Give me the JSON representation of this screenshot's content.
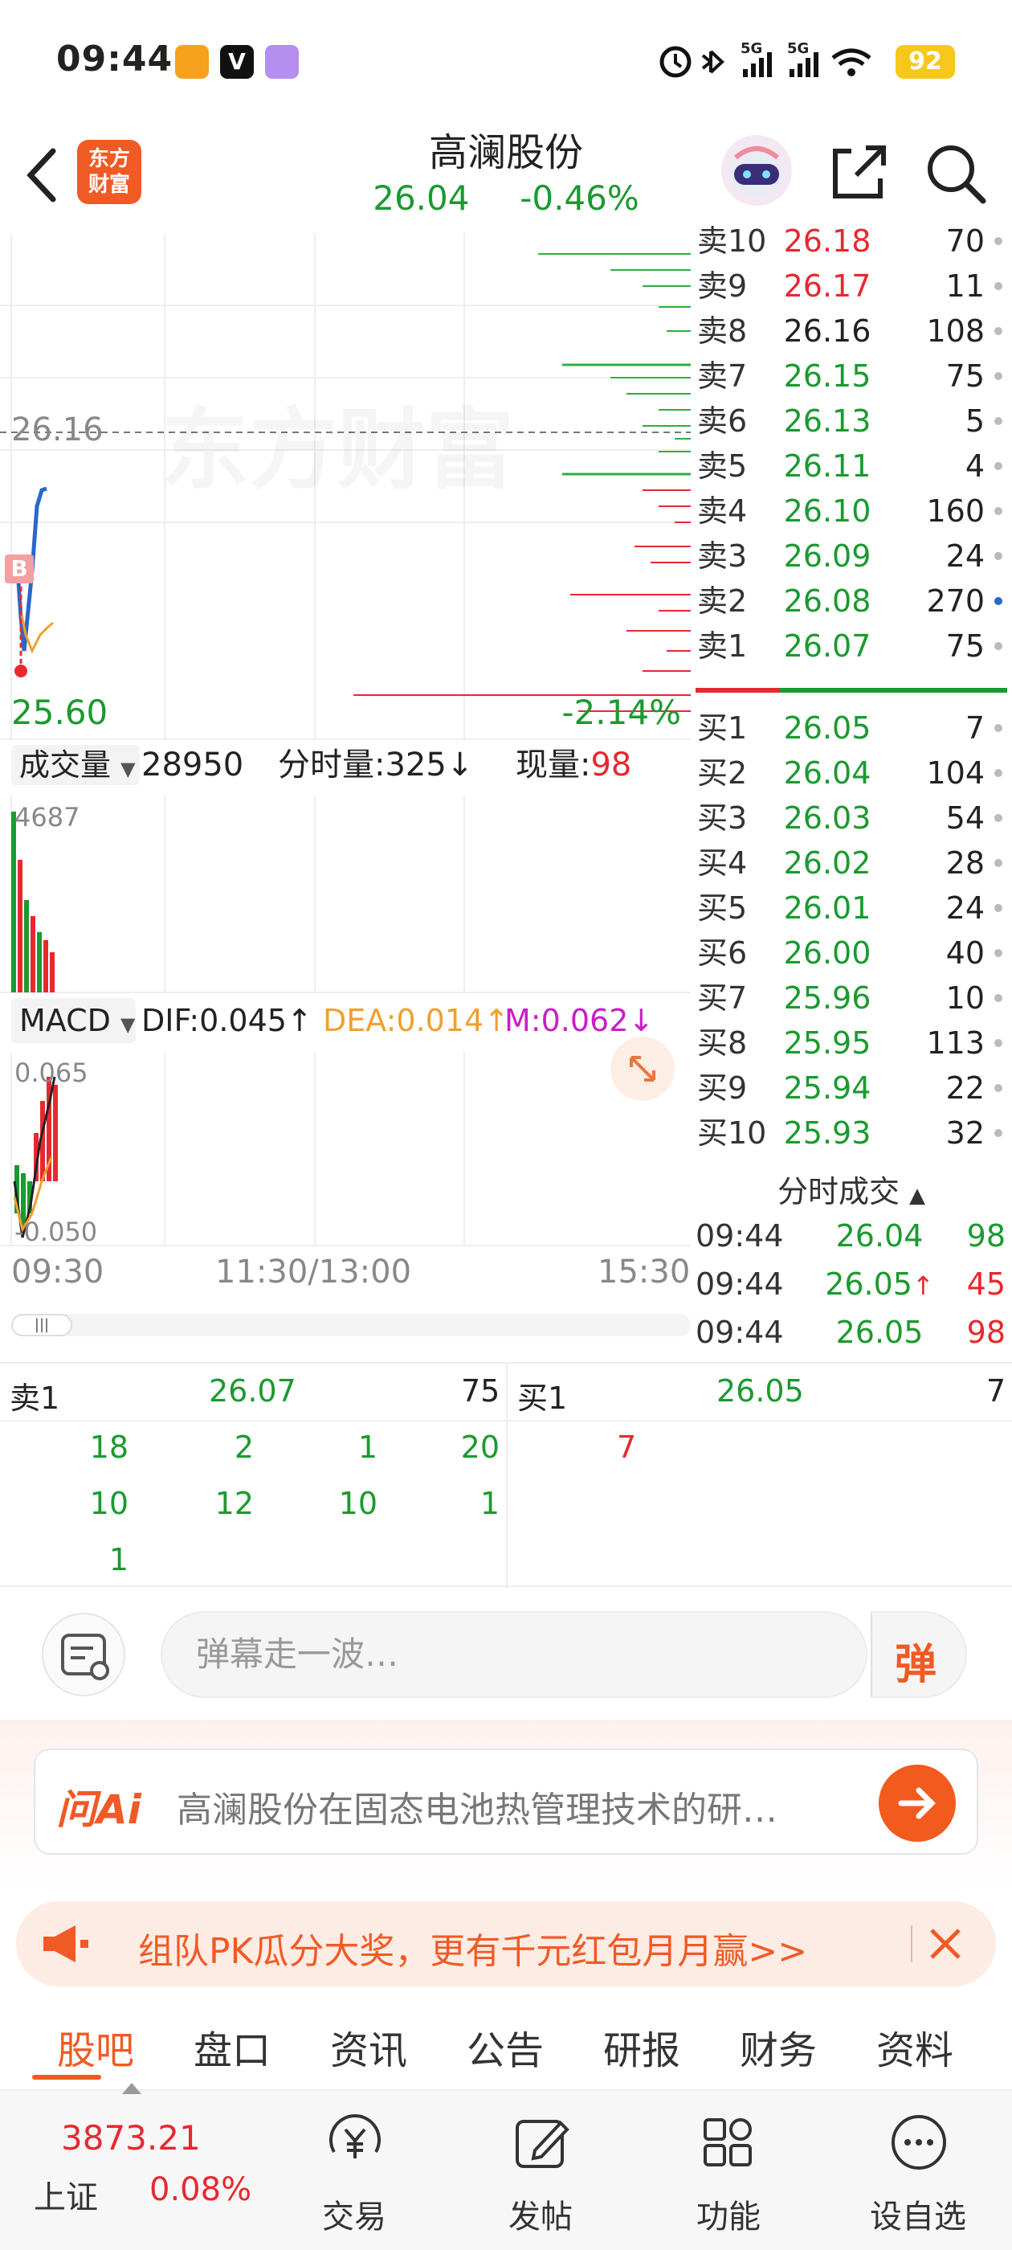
{
  "status": {
    "time": "09:44",
    "battery": "92",
    "signal_labels": [
      "5G",
      "5G"
    ]
  },
  "header": {
    "logo_text": [
      "东方",
      "财富"
    ],
    "stock_name": "高澜股份",
    "price": "26.04",
    "change_pct": "-0.46%"
  },
  "chart": {
    "watermark": "东方财富",
    "ref_price": "26.16",
    "low_price": "25.60",
    "low_pct": "-2.14%",
    "buy_marker": "B",
    "volume_bar": {
      "dropdown": "成交量",
      "total": "28950",
      "tick_label": "分时量:",
      "tick_value": "325",
      "tick_arrow": "↓",
      "now_label": "现量:",
      "now_value": "98",
      "max": "4687"
    },
    "macd_bar": {
      "dropdown": "MACD",
      "dif": "DIF:0.045",
      "dif_arrow": "↑",
      "dea": "DEA:0.014",
      "dea_arrow": "↑",
      "m": "M:0.062",
      "m_arrow": "↓",
      "top": "0.065",
      "bottom": "-0.050"
    },
    "time_axis": [
      "09:30",
      "11:30/13:00",
      "15:30"
    ]
  },
  "orderbook": {
    "sell": [
      {
        "label": "卖10",
        "price": "26.18",
        "vol": "70",
        "color": "red"
      },
      {
        "label": "卖9",
        "price": "26.17",
        "vol": "11",
        "color": "red"
      },
      {
        "label": "卖8",
        "price": "26.16",
        "vol": "108",
        "color": "black"
      },
      {
        "label": "卖7",
        "price": "26.15",
        "vol": "75",
        "color": "green"
      },
      {
        "label": "卖6",
        "price": "26.13",
        "vol": "5",
        "color": "green"
      },
      {
        "label": "卖5",
        "price": "26.11",
        "vol": "4",
        "color": "green"
      },
      {
        "label": "卖4",
        "price": "26.10",
        "vol": "160",
        "color": "green"
      },
      {
        "label": "卖3",
        "price": "26.09",
        "vol": "24",
        "color": "green"
      },
      {
        "label": "卖2",
        "price": "26.08",
        "vol": "270",
        "color": "green"
      },
      {
        "label": "卖1",
        "price": "26.07",
        "vol": "75",
        "color": "green"
      }
    ],
    "buy": [
      {
        "label": "买1",
        "price": "26.05",
        "vol": "7",
        "color": "green"
      },
      {
        "label": "买2",
        "price": "26.04",
        "vol": "104",
        "color": "green"
      },
      {
        "label": "买3",
        "price": "26.03",
        "vol": "54",
        "color": "green"
      },
      {
        "label": "买4",
        "price": "26.02",
        "vol": "28",
        "color": "green"
      },
      {
        "label": "买5",
        "price": "26.01",
        "vol": "24",
        "color": "green"
      },
      {
        "label": "买6",
        "price": "26.00",
        "vol": "40",
        "color": "green"
      },
      {
        "label": "买7",
        "price": "25.96",
        "vol": "10",
        "color": "green"
      },
      {
        "label": "买8",
        "price": "25.95",
        "vol": "113",
        "color": "green"
      },
      {
        "label": "买9",
        "price": "25.94",
        "vol": "22",
        "color": "green"
      },
      {
        "label": "买10",
        "price": "25.93",
        "vol": "32",
        "color": "green"
      }
    ],
    "trades_title": "分时成交",
    "trades": [
      {
        "time": "09:44",
        "price": "26.04",
        "arrow": "",
        "vol": "98",
        "vcolor": "green"
      },
      {
        "time": "09:44",
        "price": "26.05",
        "arrow": "↑",
        "vol": "45",
        "vcolor": "red"
      },
      {
        "time": "09:44",
        "price": "26.05",
        "arrow": "",
        "vol": "98",
        "vcolor": "red"
      }
    ]
  },
  "depth": {
    "sell_label": "卖1",
    "sell_price": "26.07",
    "sell_vol": "75",
    "buy_label": "买1",
    "buy_price": "26.05",
    "buy_vol": "7",
    "sell_queue": [
      "18",
      "2",
      "1",
      "20",
      "10",
      "12",
      "10",
      "1",
      "1"
    ],
    "buy_queue": [
      "7"
    ]
  },
  "comment": {
    "placeholder": "弹幕走一波…",
    "danmu_button": "弹"
  },
  "ai": {
    "label": "问Ai",
    "text": "高澜股份在固态电池热管理技术的研…"
  },
  "promo": {
    "text": "组队PK瓜分大奖，更有千元红包月月赢>>"
  },
  "tabs": [
    "股吧",
    "盘口",
    "资讯",
    "公告",
    "研报",
    "财务",
    "资料"
  ],
  "bottom_nav": {
    "index_value": "3873.21",
    "index_name": "上证",
    "index_pct": "0.08%",
    "items": [
      "交易",
      "发帖",
      "功能",
      "设自选"
    ]
  }
}
